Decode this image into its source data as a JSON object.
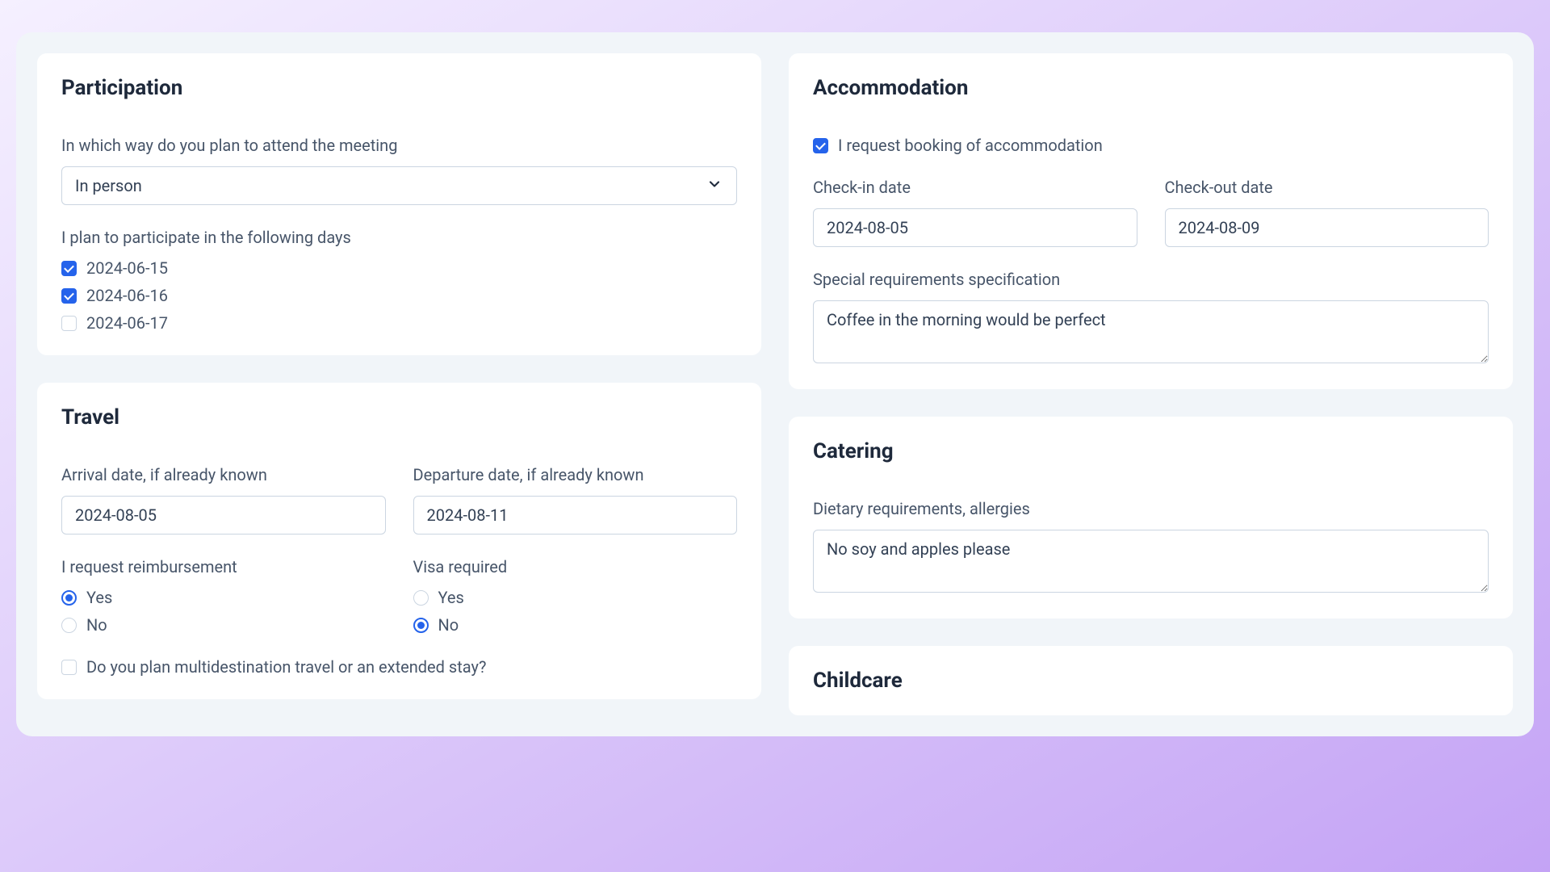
{
  "participation": {
    "title": "Participation",
    "attendance_label": "In which way do you plan to attend the meeting",
    "attendance_value": "In person",
    "days_label": "I plan to participate in the following days",
    "days": [
      {
        "label": "2024-06-15",
        "checked": true
      },
      {
        "label": "2024-06-16",
        "checked": true
      },
      {
        "label": "2024-06-17",
        "checked": false
      }
    ]
  },
  "travel": {
    "title": "Travel",
    "arrival_label": "Arrival date, if already known",
    "arrival_value": "2024-08-05",
    "departure_label": "Departure date, if already known",
    "departure_value": "2024-08-11",
    "reimbursement_label": "I request reimbursement",
    "reimbursement_yes": "Yes",
    "reimbursement_no": "No",
    "visa_label": "Visa required",
    "visa_yes": "Yes",
    "visa_no": "No",
    "multidest_label": "Do you plan multidestination travel or an extended stay?"
  },
  "accommodation": {
    "title": "Accommodation",
    "request_label": "I request booking of accommodation",
    "checkin_label": "Check-in date",
    "checkin_value": "2024-08-05",
    "checkout_label": "Check-out date",
    "checkout_value": "2024-08-09",
    "special_label": "Special requirements specification",
    "special_value": "Coffee in the morning would be perfect"
  },
  "catering": {
    "title": "Catering",
    "dietary_label": "Dietary requirements, allergies",
    "dietary_value": "No soy and apples please"
  },
  "childcare": {
    "title": "Childcare"
  }
}
